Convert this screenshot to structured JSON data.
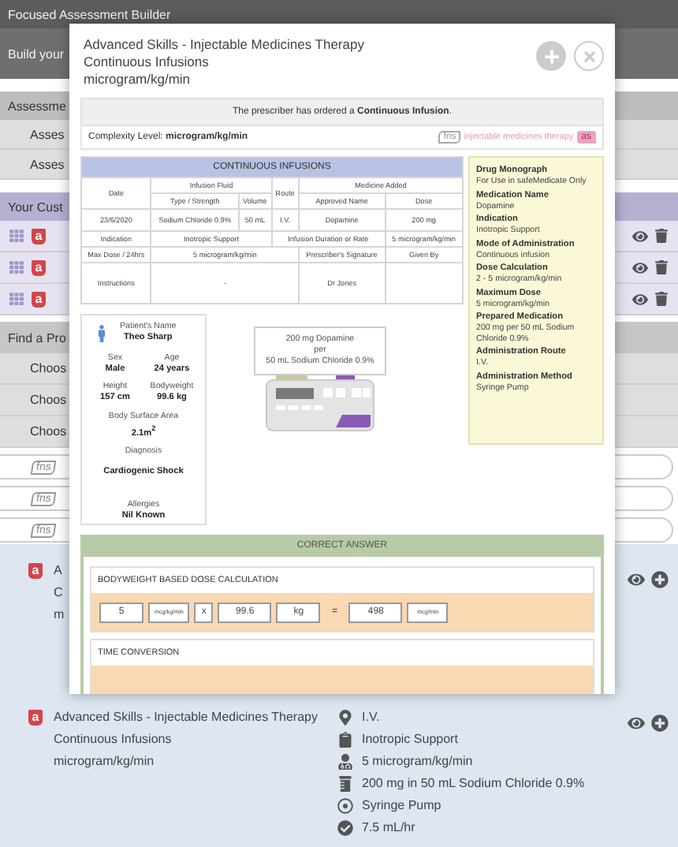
{
  "app_header": {
    "title": "Focused Assessment Builder",
    "subtitle": "Build your"
  },
  "assessment_section": {
    "heading": "Assessme",
    "items": [
      "Asses",
      "Asses"
    ]
  },
  "custom_section": {
    "heading": "Your Cust",
    "items": [
      {
        "badge": "a"
      },
      {
        "badge": "a"
      },
      {
        "badge": "a"
      }
    ]
  },
  "find_section": {
    "heading": "Find a Pro",
    "choices": [
      "Choos",
      "Choos",
      "Choos"
    ],
    "logos": [
      "fns",
      "fns",
      "fns"
    ]
  },
  "results": [
    {
      "badge": "a",
      "lines": [
        "A",
        "C",
        "m"
      ]
    },
    {
      "badge": "a",
      "lines": [
        "Advanced Skills - Injectable Medicines Therapy",
        "Continuous Infusions",
        "microgram/kg/min"
      ],
      "details": [
        {
          "kind": "route",
          "text": "I.V."
        },
        {
          "kind": "indication",
          "text": "Inotropic Support"
        },
        {
          "kind": "dose",
          "text": "5 microgram/kg/min"
        },
        {
          "kind": "preparation",
          "text": "200 mg in 50 mL Sodium Chloride 0.9%"
        },
        {
          "kind": "method",
          "text": "Syringe Pump"
        },
        {
          "kind": "rate",
          "text": "7.5 mL/hr"
        }
      ]
    }
  ],
  "modal": {
    "title_lines": [
      "Advanced Skills - Injectable Medicines Therapy",
      "Continuous Infusions",
      "microgram/kg/min"
    ],
    "prescriber_note": "The prescriber has ordered a **Continuous Infusion**.",
    "complexity": "Complexity Level: **microgram/kg/min**",
    "logo": {
      "mark": "fns",
      "name": "injectable medicines therapy",
      "badge": "as"
    },
    "chart": {
      "title": "CONTINUOUS INFUSIONS",
      "date_label": "Date",
      "fluid_label": "Infusion Fluid",
      "type_label": "Type / Strength",
      "volume_label": "Volume",
      "route_label": "Route",
      "medicine_label": "Medicine Added",
      "name_label": "Approved Name",
      "dose_label": "Dose",
      "date": "23/6/2020",
      "fluid": "Sodium Chloride 0.9%",
      "volume": "50 mL",
      "route": "I.V.",
      "medicine": "Dopamine",
      "dose": "200 mg",
      "indication_label": "Indication",
      "indication": "Inotropic Support",
      "rate_label": "Infusion Duration or Rate",
      "rate": "5 microgram/kg/min",
      "max_label": "Max Dose / 24hrs",
      "max": "5 microgram/kg/min",
      "signature_label": "Prescriber's Signature",
      "given_label": "Given By",
      "instructions_label": "Instructions",
      "instructions": "-",
      "signature": "Dr Jones"
    },
    "monograph": {
      "heading": "Drug Monograph",
      "note": "For Use in safeMedicate Only",
      "entries": [
        {
          "label": "Medication Name",
          "value": "Dopamine"
        },
        {
          "label": "Indication",
          "value": "Inotropic Support"
        },
        {
          "label": "Mode of Administration",
          "value": "Continuous infusion"
        },
        {
          "label": "Dose Calculation",
          "value": "2 - 5 microgram/kg/min"
        },
        {
          "label": "Maximum Dose",
          "value": "5 microgram/kg/min"
        },
        {
          "label": "Prepared Medication",
          "value": "200 mg per 50 mL Sodium Chloride 0.9%"
        },
        {
          "label": "Administration Route",
          "value": "I.V."
        },
        {
          "label": "Administration Method",
          "value": "Syringe Pump"
        }
      ]
    },
    "patient": {
      "name_label": "Patient's Name",
      "name": "Theo Sharp",
      "facts": [
        {
          "label": "Sex",
          "value": "Male"
        },
        {
          "label": "Age",
          "value": "24 years"
        },
        {
          "label": "Height",
          "value": "157 cm"
        },
        {
          "label": "Bodyweight",
          "value": "99.6 kg"
        }
      ],
      "bsa_label": "Body Surface Area",
      "bsa": "2.1m$^{2}$",
      "diagnosis_label": "Diagnosis",
      "diagnosis": "Cardiogenic Shock",
      "allergies_label": "Allergies",
      "allergies": "Nil Known"
    },
    "pump_label": [
      "200 mg Dopamine",
      "per",
      "50 mL Sodium Chloride 0.9%"
    ],
    "answer": {
      "heading": "CORRECT ANSWER",
      "sections": [
        {
          "title": "BODYWEIGHT BASED DOSE CALCULATION",
          "terms": [
            {
              "kind": "value",
              "text": "5"
            },
            {
              "kind": "unit",
              "text": "mcg/kg/min"
            },
            {
              "kind": "operator",
              "text": "x"
            },
            {
              "kind": "value",
              "text": "99.6"
            },
            {
              "kind": "value",
              "text": "kg"
            },
            {
              "kind": "sign",
              "text": "="
            },
            {
              "kind": "value",
              "text": "498"
            },
            {
              "kind": "unit",
              "text": "mcg/min"
            }
          ]
        },
        {
          "title": "TIME CONVERSION"
        }
      ]
    }
  }
}
